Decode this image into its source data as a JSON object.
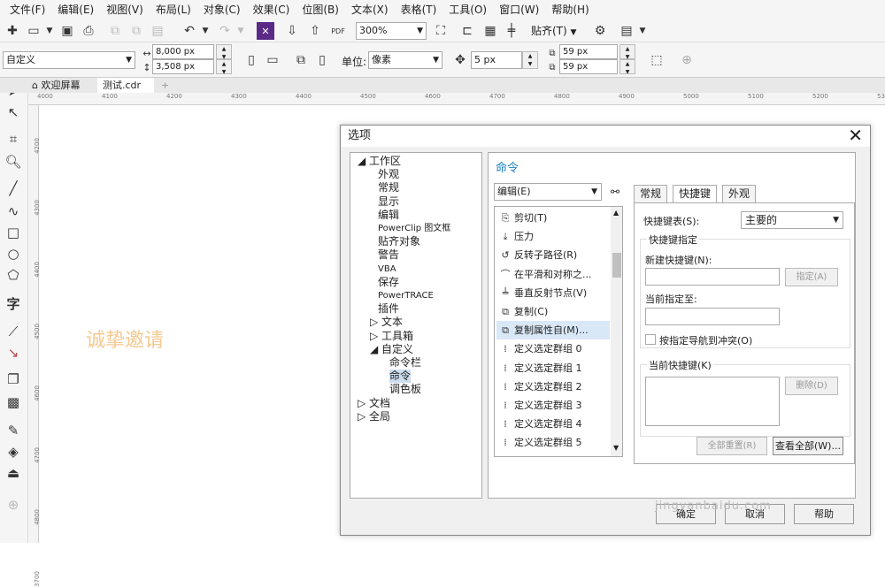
{
  "menu": [
    "文件(F)",
    "编辑(E)",
    "视图(V)",
    "布局(L)",
    "对象(C)",
    "效果(C)",
    "位图(B)",
    "文本(X)",
    "表格(T)",
    "工具(O)",
    "窗口(W)",
    "帮助(H)"
  ],
  "toolbar1": {
    "zoom": "300%",
    "snap_label": "贴齐(T)",
    "pdf_label": "PDF"
  },
  "toolbar2": {
    "preset": "自定义",
    "width": "8,000 px",
    "height": "3,508 px",
    "unit_label": "单位:",
    "unit_value": "像素",
    "nudge": "5 px",
    "dup_x": "59 px",
    "dup_y": "59 px"
  },
  "tabs": {
    "welcome": "欢迎屏幕",
    "doc": "测试.cdr",
    "add": "+"
  },
  "ruler_labels": [
    "4000",
    "4100",
    "4200",
    "4300",
    "4400",
    "4500",
    "4600",
    "4700",
    "4800",
    "4900",
    "5000",
    "5100",
    "5200",
    "5300"
  ],
  "vruler_labels": [
    "4200",
    "4300",
    "4400",
    "4500",
    "4600",
    "4700",
    "4800",
    "3700"
  ],
  "canvas_text": "诚挚邀请",
  "dialog": {
    "title": "选项",
    "close": "✕",
    "tree": [
      {
        "label": "◢ 工作区",
        "level": 0
      },
      {
        "label": "外观",
        "level": 2
      },
      {
        "label": "常规",
        "level": 2
      },
      {
        "label": "显示",
        "level": 2
      },
      {
        "label": "编辑",
        "level": 2
      },
      {
        "label": "PowerClip 图文框",
        "level": 2
      },
      {
        "label": "贴齐对象",
        "level": 2
      },
      {
        "label": "警告",
        "level": 2
      },
      {
        "label": "VBA",
        "level": 2
      },
      {
        "label": "保存",
        "level": 2
      },
      {
        "label": "PowerTRACE",
        "level": 2
      },
      {
        "label": "插件",
        "level": 2
      },
      {
        "label": "▷ 文本",
        "level": 1
      },
      {
        "label": "▷ 工具箱",
        "level": 1
      },
      {
        "label": "◢ 自定义",
        "level": 1
      },
      {
        "label": "命令栏",
        "level": 3
      },
      {
        "label": "命令",
        "level": 3
      },
      {
        "label": "调色板",
        "level": 3
      },
      {
        "label": "▷ 文档",
        "level": 0
      },
      {
        "label": "▷ 全局",
        "level": 0
      }
    ],
    "panel_title": "命令",
    "category": "编辑(E)",
    "commands": [
      {
        "icon": "⎘",
        "label": "剪切(T)"
      },
      {
        "icon": "⤓",
        "label": "压力"
      },
      {
        "icon": "↺",
        "label": "反转子路径(R)"
      },
      {
        "icon": "⌒",
        "label": "在平滑和对称之..."
      },
      {
        "icon": "╧",
        "label": "垂直反射节点(V)"
      },
      {
        "icon": "⧉",
        "label": "复制(C)"
      },
      {
        "icon": "⧉",
        "label": "复制属性自(M)..."
      },
      {
        "icon": "⁞",
        "label": "定义选定群组 0"
      },
      {
        "icon": "⁞",
        "label": "定义选定群组 1"
      },
      {
        "icon": "⁞",
        "label": "定义选定群组 2"
      },
      {
        "icon": "⁞",
        "label": "定义选定群组 3"
      },
      {
        "icon": "⁞",
        "label": "定义选定群组 4"
      },
      {
        "icon": "⁞",
        "label": "定义选定群组 5"
      }
    ],
    "panel_tabs": [
      "常规",
      "快捷键",
      "外观"
    ],
    "shortcut_table_label": "快捷键表(S):",
    "shortcut_table_value": "主要的",
    "assign_group": "快捷键指定",
    "new_key_label": "新建快捷键(N):",
    "assign_btn": "指定(A)",
    "current_assign_label": "当前指定至:",
    "nav_conflict": "按指定导航到冲突(O)",
    "current_keys_label": "当前快捷键(K)",
    "delete_btn": "删除(D)",
    "reset_all": "全部重置(R)",
    "view_all": "查看全部(W)...",
    "ok": "确定",
    "cancel": "取消",
    "help": "帮助"
  },
  "watermark": "jingyanbaidu.com"
}
